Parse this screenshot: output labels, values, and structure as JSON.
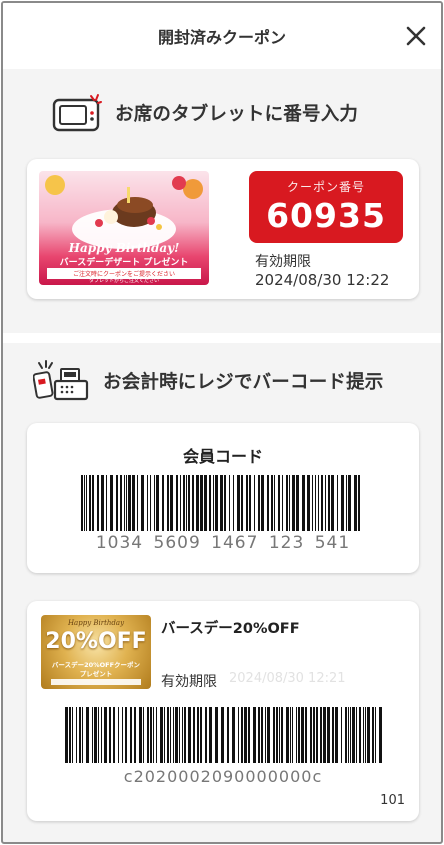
{
  "header": {
    "title": "開封済みクーポン"
  },
  "section1": {
    "title": "お席のタブレットに番号入力"
  },
  "coupon_card": {
    "code_caption": "クーポン番号",
    "code": "60935",
    "expiry_label": "有効期限",
    "expiry_value": "2024/08/30 12:22",
    "banner": {
      "headline": "Happy Birthday!",
      "subline": "バースデーデザート プレゼント",
      "note": "ご注文時にクーポンをご提示ください",
      "footnote": "タブレットからご注文ください"
    }
  },
  "section2": {
    "title": "お会計時にレジでバーコード提示"
  },
  "member_card": {
    "title": "会員コード",
    "barcode_number": "1034  5609  1467  123  541"
  },
  "birthday_card": {
    "title": "バースデー20%OFF",
    "expiry_label": "有効期限",
    "expiry_value": "2024/08/30 12:21",
    "barcode_number": "c2020002090000000c",
    "footer_number": "101",
    "banner": {
      "script": "Happy Birthday",
      "big": "20%OFF",
      "line": "バースデー20%OFFクーポン",
      "line2": "プレゼント"
    }
  },
  "colors": {
    "accent_red": "#d81920",
    "gold": "#c89a3a"
  }
}
